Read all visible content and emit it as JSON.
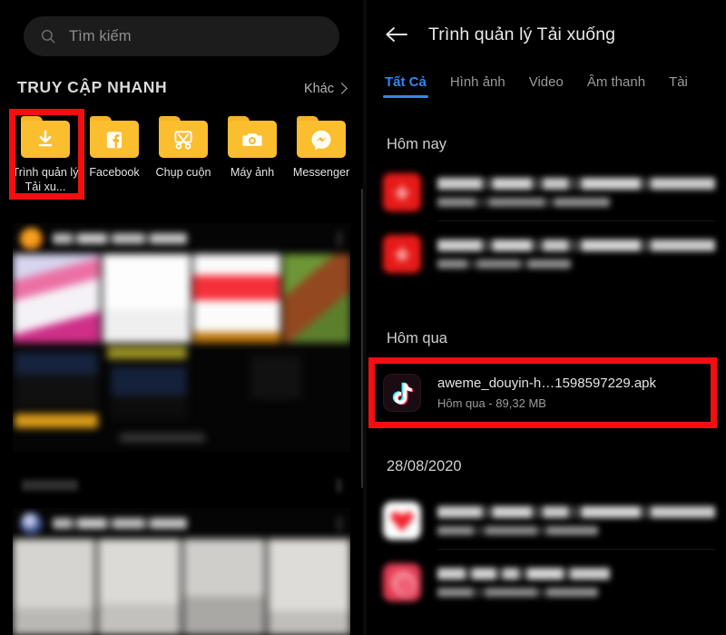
{
  "colors": {
    "background": "#000000",
    "folder_yellow": "#fbbe2e",
    "accent_blue": "#2f88f0",
    "highlight_red": "#f40e10",
    "pdf_red": "#e61a18"
  },
  "left_panel": {
    "search": {
      "placeholder": "Tìm kiếm",
      "value": "",
      "icon": "search-icon"
    },
    "quick_access": {
      "title": "TRUY CẬP NHANH",
      "more_label": "Khác",
      "more_icon": "chevron-right-icon",
      "folders": [
        {
          "label": "Trình quản lý Tải xu...",
          "icon": "download-folder-icon",
          "highlighted": true
        },
        {
          "label": "Facebook",
          "icon": "facebook-folder-icon",
          "highlighted": false
        },
        {
          "label": "Chụp cuộn",
          "icon": "screenshot-folder-icon",
          "highlighted": false
        },
        {
          "label": "Máy ảnh",
          "icon": "camera-folder-icon",
          "highlighted": false
        },
        {
          "label": "Messenger",
          "icon": "messenger-folder-icon",
          "highlighted": false
        }
      ]
    },
    "feed_cards": [
      {
        "name": "feed-card-blurred-1",
        "avatar": "avatar-orange",
        "more_icon": "more-options-icon"
      },
      {
        "name": "feed-card-blurred-2",
        "avatar": "avatar-blue",
        "more_icon": "more-options-icon"
      }
    ]
  },
  "right_panel": {
    "header": {
      "back_icon": "back-arrow-icon",
      "title": "Trình quản lý Tải xuống"
    },
    "tabs": [
      {
        "label": "Tất Cả",
        "active": true
      },
      {
        "label": "Hình ảnh",
        "active": false
      },
      {
        "label": "Video",
        "active": false
      },
      {
        "label": "Âm thanh",
        "active": false
      },
      {
        "label": "Tài",
        "active": false
      }
    ],
    "sections": [
      {
        "header": "Hôm nay",
        "files": [
          {
            "name": "",
            "meta": "",
            "icon": "pdf-file-icon",
            "blurred": true,
            "highlighted": false
          },
          {
            "name": "",
            "meta": "",
            "icon": "pdf-file-icon",
            "blurred": true,
            "highlighted": false
          }
        ]
      },
      {
        "header": "Hôm qua",
        "files": [
          {
            "name": "aweme_douyin-h…1598597229.apk",
            "meta": "Hôm qua - 89,32 MB",
            "icon": "tiktok-app-icon",
            "blurred": false,
            "highlighted": true
          }
        ]
      },
      {
        "header": "28/08/2020",
        "files": [
          {
            "name": "",
            "meta": "",
            "icon": "apk-file-icon-red-heart",
            "blurred": true,
            "highlighted": false
          },
          {
            "name": "",
            "meta": "",
            "icon": "apk-file-icon-pink",
            "blurred": true,
            "highlighted": false
          }
        ]
      }
    ]
  }
}
